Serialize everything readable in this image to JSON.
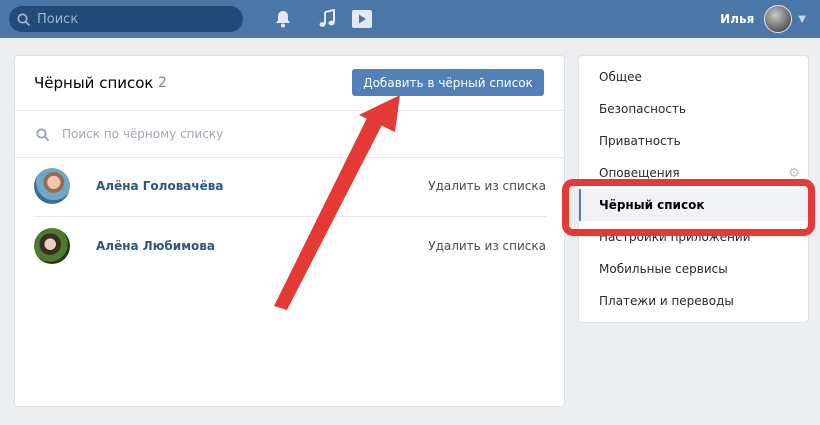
{
  "topbar": {
    "search_placeholder": "Поиск",
    "user_name": "Илья",
    "icons": [
      "search-icon",
      "bell-icon",
      "music-icon",
      "play-icon",
      "chevron-down-icon"
    ]
  },
  "blacklist": {
    "title": "Чёрный список",
    "count": "2",
    "add_button": "Добавить в чёрный список",
    "search_placeholder": "Поиск по чёрному списку",
    "users": [
      {
        "name": "Алёна Головачёва",
        "action": "Удалить из списка"
      },
      {
        "name": "Алёна Любимова",
        "action": "Удалить из списка"
      }
    ]
  },
  "sidebar": {
    "items": [
      {
        "label": "Общее"
      },
      {
        "label": "Безопасность"
      },
      {
        "label": "Приватность"
      },
      {
        "label": "Оповещения"
      },
      {
        "label": "Чёрный список",
        "active": true
      },
      {
        "label": "Настройки приложений"
      },
      {
        "label": "Мобильные сервисы"
      },
      {
        "label": "Платежи и переводы"
      }
    ]
  },
  "colors": {
    "topbar": "#4a76a8",
    "accent": "#5181b8",
    "link": "#2a5885",
    "highlight": "#e53935"
  }
}
